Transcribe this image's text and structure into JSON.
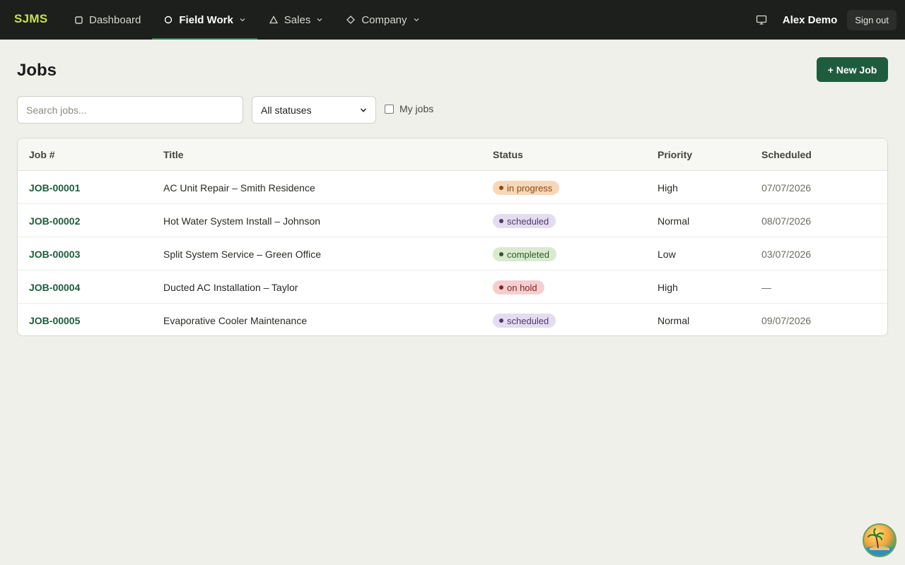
{
  "app": {
    "brand": "SJMS"
  },
  "nav": {
    "items": [
      {
        "label": "Dashboard",
        "icon": "square-icon",
        "dropdown": false,
        "active": false
      },
      {
        "label": "Field Work",
        "icon": "circle-icon",
        "dropdown": true,
        "active": true
      },
      {
        "label": "Sales",
        "icon": "triangle-icon",
        "dropdown": true,
        "active": false
      },
      {
        "label": "Company",
        "icon": "diamond-icon",
        "dropdown": true,
        "active": false
      }
    ],
    "user_name": "Alex Demo",
    "signout_label": "Sign out"
  },
  "page": {
    "title": "Jobs",
    "new_job_label": "+ New Job"
  },
  "filters": {
    "search_placeholder": "Search jobs...",
    "status_selected": "All statuses",
    "my_jobs_label": "My jobs",
    "my_jobs_checked": false
  },
  "table": {
    "headers": [
      "Job #",
      "Title",
      "Status",
      "Priority",
      "Scheduled"
    ],
    "rows": [
      {
        "job": "JOB-00001",
        "title": "AC Unit Repair – Smith Residence",
        "status": "in progress",
        "priority": "High",
        "scheduled": "07/07/2026"
      },
      {
        "job": "JOB-00002",
        "title": "Hot Water System Install – Johnson",
        "status": "scheduled",
        "priority": "Normal",
        "scheduled": "08/07/2026"
      },
      {
        "job": "JOB-00003",
        "title": "Split System Service – Green Office",
        "status": "completed",
        "priority": "Low",
        "scheduled": "03/07/2026"
      },
      {
        "job": "JOB-00004",
        "title": "Ducted AC Installation – Taylor",
        "status": "on hold",
        "priority": "High",
        "scheduled": "—"
      },
      {
        "job": "JOB-00005",
        "title": "Evaporative Cooler Maintenance",
        "status": "scheduled",
        "priority": "Normal",
        "scheduled": "09/07/2026"
      }
    ]
  },
  "status_colors": {
    "in progress": {
      "bg": "#f8d7b8",
      "fg": "#8a4a14"
    },
    "scheduled": {
      "bg": "#e4dcef",
      "fg": "#4d3b6b"
    },
    "completed": {
      "bg": "#d9ead0",
      "fg": "#2f5a24"
    },
    "on hold": {
      "bg": "#f5cfcf",
      "fg": "#8a2020"
    }
  },
  "colors": {
    "accent": "#1f5c3e",
    "brand": "#c8e04a",
    "topbar": "#1c1f1c"
  }
}
